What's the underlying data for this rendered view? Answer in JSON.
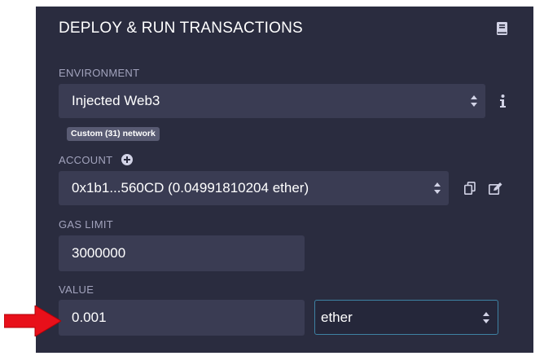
{
  "header": {
    "title": "DEPLOY & RUN TRANSACTIONS",
    "doc_icon": "book-icon"
  },
  "environment": {
    "label": "ENVIRONMENT",
    "value": "Injected Web3",
    "network_badge": "Custom (31) network",
    "info_icon": "info-icon"
  },
  "account": {
    "label": "ACCOUNT",
    "value": "0x1b1...560CD (0.04991810204 ether)",
    "add_icon": "plus-circle-icon",
    "copy_icon": "copy-icon",
    "edit_icon": "edit-icon"
  },
  "gas_limit": {
    "label": "GAS LIMIT",
    "value": "3000000"
  },
  "value": {
    "label": "VALUE",
    "amount": "0.001",
    "unit": "ether"
  },
  "colors": {
    "panel_bg": "#2a2c3f",
    "field_bg": "#3a3c53",
    "focus_border": "#3e82a3",
    "arrow": "#e8101a"
  }
}
